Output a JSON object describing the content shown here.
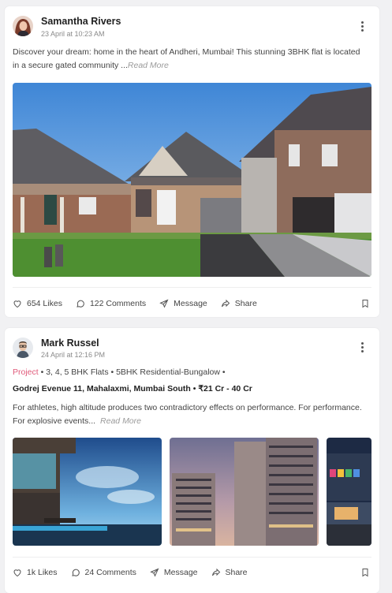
{
  "posts": [
    {
      "author": "Samantha Rivers",
      "timestamp": "23 April at 10:23 AM",
      "text": "Discover your dream: home in the heart of Andheri, Mumbai! This stunning 3BHK flat is located in a secure gated community ...",
      "read_more": "Read More",
      "likes": "654 Likes",
      "comments": "122 Comments",
      "message": "Message",
      "share": "Share"
    },
    {
      "author": "Mark Russel",
      "timestamp": "24 April at 12:16 PM",
      "tag": "Project",
      "tagline": "• 3, 4, 5 BHK Flats • 5BHK Residential-Bungalow •",
      "address": "Godrej Evenue 11, Mahalaxmi, Mumbai South • ₹21 Cr - 40 Cr",
      "text": "For athletes, high altitude produces two contradictory effects on performance. For performance. For explosive events...",
      "read_more": "Read More",
      "likes": "1k Likes",
      "comments": "24 Comments",
      "message": "Message",
      "share": "Share"
    }
  ],
  "icons": [
    "kebab-menu-icon",
    "heart-icon",
    "comment-icon",
    "send-icon",
    "share-icon",
    "bookmark-icon"
  ],
  "colors": {
    "project_tag": "#e05a7a",
    "background": "#f1f1f3"
  }
}
